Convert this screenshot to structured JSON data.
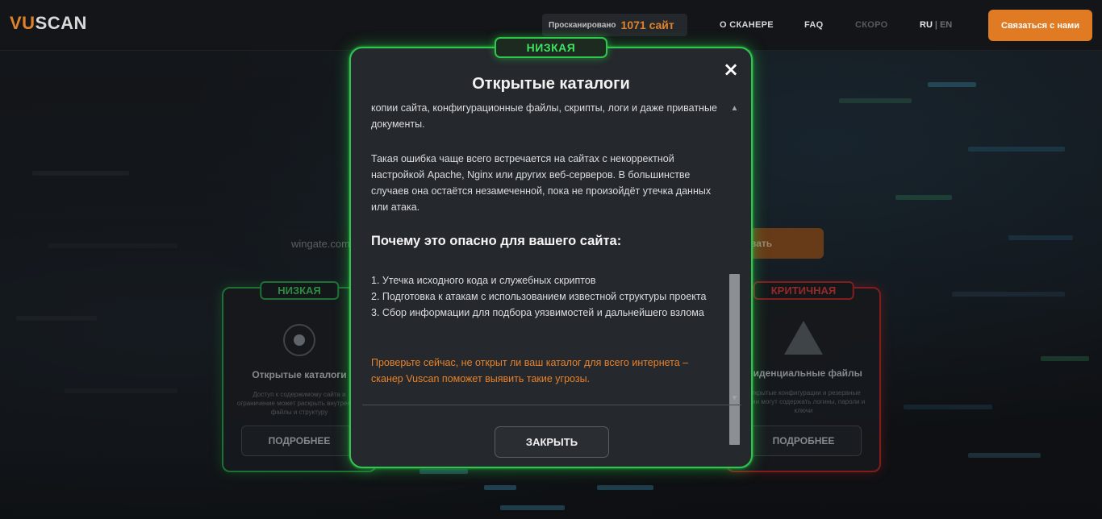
{
  "header": {
    "logo_accent": "VU",
    "logo_rest": "SCAN",
    "scanned_label": "Просканировано",
    "scanned_count": "1071 сайт",
    "nav": [
      "О СКАНЕРЕ",
      "FAQ",
      "СКОРО"
    ],
    "lang_active": "RU",
    "lang_sep": "|",
    "lang_other": "EN",
    "contact_label": "Связаться с нами"
  },
  "background": {
    "url_input_value": "wingate.com",
    "scan_button_label": "вать",
    "card_left": {
      "badge": "НИЗКАЯ",
      "title": "Открытые каталоги",
      "desc": "Доступ к содержимому сайта и ограничение может раскрыть внутренние файлы и структуру",
      "more": "ПОДРОБНЕЕ"
    },
    "card_right": {
      "badge": "КРИТИЧНАЯ",
      "title": "фиденциальные файлы",
      "desc": "Открытые конфигурации и резервные копии могут содержать логины, пароли и ключи",
      "more": "ПОДРОБНЕЕ"
    }
  },
  "modal": {
    "severity": "НИЗКАЯ",
    "title": "Открытые каталоги",
    "close_icon": "×",
    "para1": "копии сайта, конфигурационные файлы, скрипты, логи и даже приватные документы.",
    "para2": "Такая ошибка чаще всего встречается на сайтах с некорректной настройкой Apache, Nginx или других веб-серверов. В большинстве случаев она остаётся незамеченной, пока не произойдёт утечка данных или атака.",
    "heading": "Почему это опасно для вашего сайта:",
    "risks": [
      "1. Утечка исходного кода и служебных скриптов",
      "2. Подготовка к атакам с использованием известной структуры проекта",
      "3. Сбор информации для подбора уязвимостей и дальнейшего взлома"
    ],
    "cta": "Проверьте сейчас, не открыт ли ваш каталог для всего интернета – сканер Vuscan поможет выявить такие угрозы.",
    "close_button": "ЗАКРЫТЬ"
  },
  "colors": {
    "accent": "#e07b24",
    "low_green": "#2fc64e",
    "critical_red": "#c42828"
  }
}
